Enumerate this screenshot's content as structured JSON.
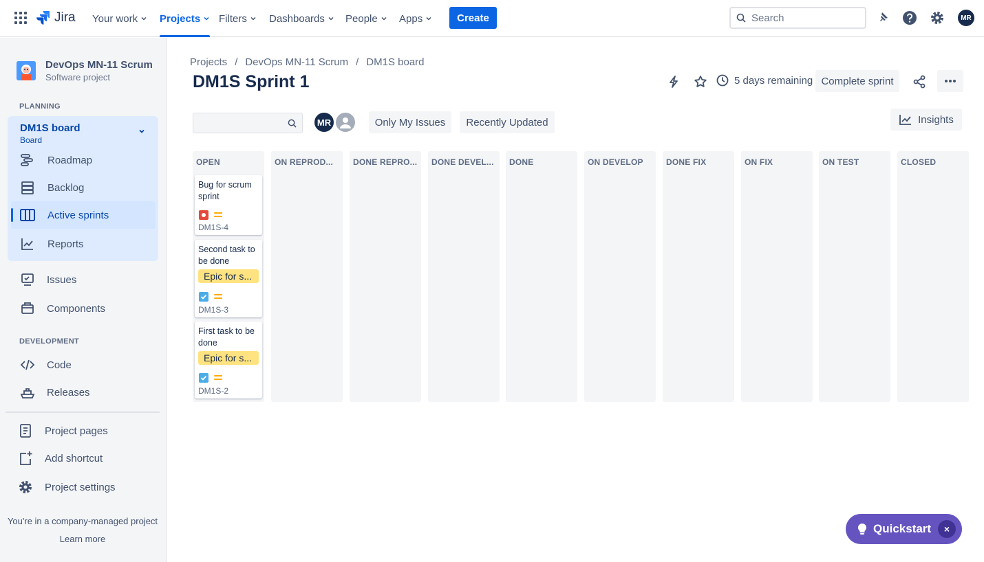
{
  "topnav": {
    "logo": "Jira",
    "items": [
      {
        "label": "Your work"
      },
      {
        "label": "Projects"
      },
      {
        "label": "Filters"
      },
      {
        "label": "Dashboards"
      },
      {
        "label": "People"
      },
      {
        "label": "Apps"
      }
    ],
    "create_label": "Create",
    "search_placeholder": "Search",
    "avatar_initials": "MR"
  },
  "sidebar": {
    "project_name": "DevOps MN-11 Scrum",
    "project_type": "Software project",
    "planning_label": "PLANNING",
    "board_name": "DM1S board",
    "board_sub": "Board",
    "planning_items": [
      {
        "label": "Roadmap"
      },
      {
        "label": "Backlog"
      },
      {
        "label": "Active sprints"
      },
      {
        "label": "Reports"
      }
    ],
    "items": [
      {
        "label": "Issues"
      },
      {
        "label": "Components"
      }
    ],
    "development_label": "DEVELOPMENT",
    "dev_items": [
      {
        "label": "Code"
      },
      {
        "label": "Releases"
      }
    ],
    "bottom_items": [
      {
        "label": "Project pages"
      },
      {
        "label": "Add shortcut"
      },
      {
        "label": "Project settings"
      }
    ],
    "footer_note": "You're in a company-managed project",
    "learn_more": "Learn more"
  },
  "main": {
    "breadcrumb": [
      "Projects",
      "/",
      "DevOps MN-11 Scrum",
      "/",
      "DM1S board"
    ],
    "title": "DM1S Sprint 1",
    "remaining": "5 days remaining",
    "complete_label": "Complete sprint",
    "avatar_initials": "MR",
    "filters": [
      "Only My Issues",
      "Recently Updated"
    ],
    "insights_label": "Insights",
    "columns": [
      "OPEN",
      "ON REPROD...",
      "DONE REPRO...",
      "DONE DEVEL...",
      "DONE",
      "ON DEVELOP",
      "DONE FIX",
      "ON FIX",
      "ON TEST",
      "CLOSED"
    ],
    "cards": [
      {
        "title": "Bug for scrum sprint",
        "key": "DM1S-4",
        "type": "bug"
      },
      {
        "title": "Second task to be done",
        "epic": "Epic for s...",
        "key": "DM1S-3",
        "type": "task"
      },
      {
        "title": "First task to be done",
        "epic": "Epic for s...",
        "key": "DM1S-2",
        "type": "task"
      }
    ]
  },
  "quickstart": {
    "label": "Quickstart",
    "close": "×"
  },
  "colors": {
    "accent": "#0c66e4",
    "quickstart": "#6554c0",
    "epic": "#ffe380",
    "bug": "#e5493a",
    "task": "#4bade8"
  }
}
